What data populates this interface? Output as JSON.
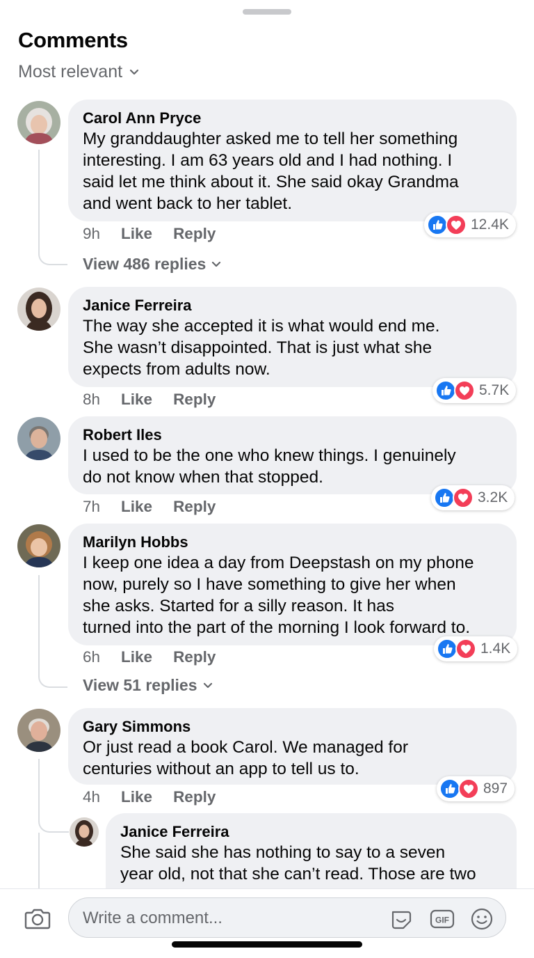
{
  "header": {
    "title": "Comments",
    "sort_label": "Most relevant"
  },
  "comments": [
    {
      "author": "Carol Ann Pryce",
      "text": "My granddaughter asked me to tell her something\ninteresting. I am 63 years old and I had nothing. I\nsaid let me think about it. She said okay Grandma\nand went back to her tablet.",
      "time": "9h",
      "like": "Like",
      "reply": "Reply",
      "reactions": "12.4K",
      "view_replies": "View 486 replies"
    },
    {
      "author": "Janice Ferreira",
      "text": "The way she accepted it is what would end me.\nShe wasn’t disappointed. That is just what she\nexpects from adults now.",
      "time": "8h",
      "like": "Like",
      "reply": "Reply",
      "reactions": "5.7K"
    },
    {
      "author": "Robert Iles",
      "text": "I used to be the one who knew things. I genuinely\ndo not know when that stopped.",
      "time": "7h",
      "like": "Like",
      "reply": "Reply",
      "reactions": "3.2K"
    },
    {
      "author": "Marilyn Hobbs",
      "text": "I keep one idea a day from Deepstash on my phone\nnow, purely so I have something to give her when\nshe asks. Started for a silly reason. It has\nturned into the part of the morning I look forward to.",
      "time": "6h",
      "like": "Like",
      "reply": "Reply",
      "reactions": "1.4K",
      "view_replies": "View 51 replies"
    },
    {
      "author": "Gary Simmons",
      "text": "Or just read a book Carol. We managed for\ncenturies without an app to tell us to.",
      "time": "4h",
      "like": "Like",
      "reply": "Reply",
      "reactions": "897"
    }
  ],
  "reply": {
    "author": "Janice Ferreira",
    "text": "She said she has nothing to say to a seven\nyear old, not that she can’t read. Those are two\nkinds of old I think. That one of us has."
  },
  "composer": {
    "placeholder": "Write a comment..."
  },
  "colors": {
    "like_blue": "#1877f2",
    "love_red": "#f33e58",
    "bubble": "#eff0f3",
    "muted": "#65676b"
  },
  "icons": [
    "camera-icon",
    "sticker-icon",
    "gif-icon",
    "emoji-icon",
    "like-reaction-icon",
    "love-reaction-icon",
    "chevron-down-icon"
  ]
}
